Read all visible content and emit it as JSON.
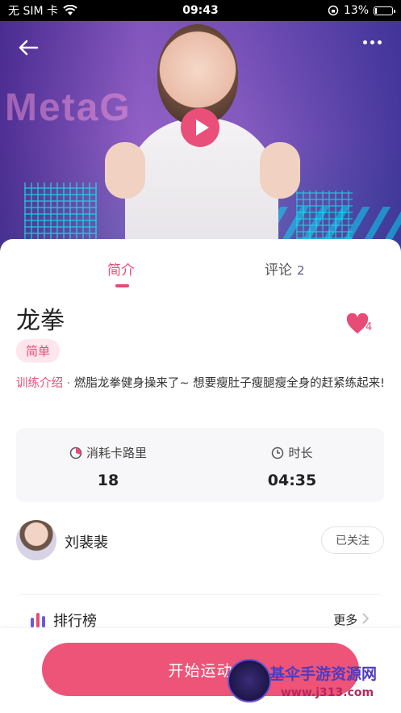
{
  "status_bar": {
    "carrier": "无 SIM 卡",
    "time": "09:43",
    "battery": "13%",
    "battery_level": 0.13
  },
  "video": {
    "back_icon": "arrow-left-icon",
    "more_icon": "more-dots-icon",
    "play_icon": "play-icon",
    "play_color": "#ea4f7a"
  },
  "tabs": [
    {
      "label": "简介",
      "active": true
    },
    {
      "label": "评论",
      "count": "2",
      "active": false
    }
  ],
  "course": {
    "title": "龙拳",
    "like_count": "4",
    "difficulty": "简单",
    "intro_label": "训练介绍 · ",
    "intro_text": "燃脂龙拳健身操来了~ 想要瘦肚子瘦腿瘦全身的赶紧练起来!"
  },
  "stats": [
    {
      "label": "消耗卡路里",
      "icon": "calorie-icon",
      "value": "18"
    },
    {
      "label": "时长",
      "icon": "clock-icon",
      "value": "04:35"
    }
  ],
  "author": {
    "name": "刘裴裴",
    "follow_label": "已关注"
  },
  "ranking": {
    "title": "排行榜",
    "more_label": "更多"
  },
  "actions": {
    "start_label": "开始运动"
  },
  "watermark": {
    "line1": "基伞手游资源网",
    "line2": "www.j313.com"
  },
  "colors": {
    "accent": "#e84b76",
    "button": "#ed5477"
  }
}
